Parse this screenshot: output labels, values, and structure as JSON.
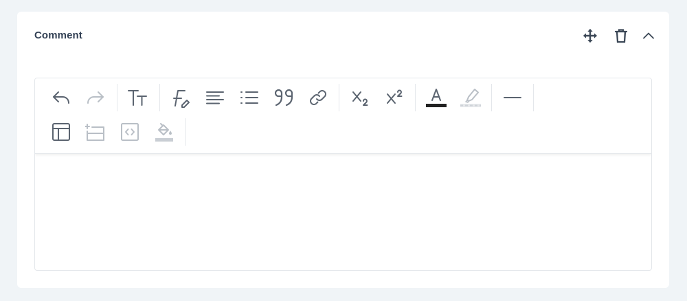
{
  "card": {
    "title": "Comment"
  },
  "header_actions": [
    {
      "icon": "move-icon"
    },
    {
      "icon": "trash-icon"
    },
    {
      "icon": "chevron-up-icon"
    }
  ],
  "toolbar": {
    "row1": [
      {
        "icon": "undo-icon",
        "enabled": true
      },
      {
        "icon": "redo-icon",
        "enabled": false
      },
      {
        "icon": "font-size-icon",
        "enabled": true
      },
      {
        "icon": "font-family-icon",
        "enabled": true
      },
      {
        "icon": "align-left-icon",
        "enabled": true
      },
      {
        "icon": "bulleted-list-icon",
        "enabled": true
      },
      {
        "icon": "blockquote-icon",
        "enabled": true
      },
      {
        "icon": "link-icon",
        "enabled": true
      },
      {
        "icon": "subscript-icon",
        "enabled": true
      },
      {
        "icon": "superscript-icon",
        "enabled": true
      },
      {
        "icon": "font-color-icon",
        "enabled": true,
        "swatch": "#222222"
      },
      {
        "icon": "highlight-icon",
        "enabled": false
      },
      {
        "icon": "horizontal-line-icon",
        "enabled": true
      }
    ],
    "row2": [
      {
        "icon": "table-icon",
        "enabled": true
      },
      {
        "icon": "insert-row-icon",
        "enabled": false
      },
      {
        "icon": "source-code-icon",
        "enabled": false
      },
      {
        "icon": "fill-color-icon",
        "enabled": false
      }
    ]
  },
  "editor": {
    "content": ""
  },
  "colors": {
    "background": "#f0f4f7",
    "card": "#ffffff",
    "title": "#334155",
    "icon_active": "#5b6470",
    "icon_disabled": "#b9bfc6",
    "border": "#e4e7eb"
  }
}
